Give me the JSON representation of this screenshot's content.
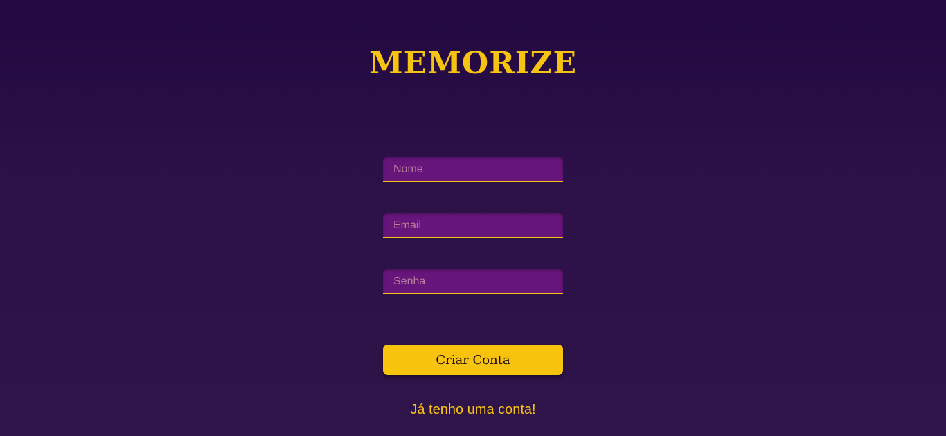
{
  "app": {
    "logo": "MEMORIZE"
  },
  "form": {
    "name_placeholder": "Nome",
    "email_placeholder": "Email",
    "password_placeholder": "Senha",
    "submit_label": "Criar Conta",
    "login_link": "Já tenho uma conta!"
  },
  "colors": {
    "background": "#2b1147",
    "accent": "#f6c311",
    "input_bg": "#66157a"
  }
}
